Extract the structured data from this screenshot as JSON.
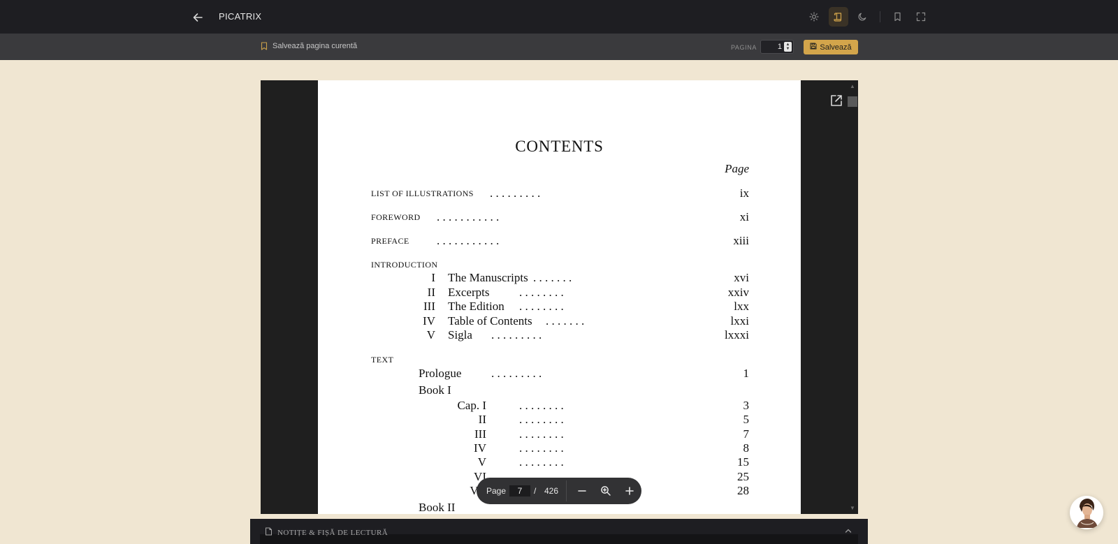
{
  "header": {
    "title": "PICATRIX"
  },
  "toolbar": {
    "save_current_label": "Salvează pagina curentă",
    "pagina_label": "PAGINA",
    "page_value": "1",
    "save_button_label": "Salvează"
  },
  "document": {
    "title": "CONTENTS",
    "page_header": "Page",
    "front_matter": [
      {
        "label": "LIST OF ILLUSTRATIONS",
        "dots": ". . . . . . . . .",
        "page": "ix"
      },
      {
        "label": "FOREWORD",
        "dots": ". . . . . . . . . . .",
        "page": "xi"
      },
      {
        "label": "PREFACE",
        "dots": ". . . . . . . . . . .",
        "page": "xiii"
      }
    ],
    "introduction_heading": "INTRODUCTION",
    "introduction": [
      {
        "num": "I",
        "label": "The Manuscripts",
        "dots": ". . . . . . .",
        "page": "xvi"
      },
      {
        "num": "II",
        "label": "Excerpts",
        "dots": ". . . . . . . .",
        "page": "xxiv"
      },
      {
        "num": "III",
        "label": "The Edition",
        "dots": ". . . . . . . .",
        "page": "lxx"
      },
      {
        "num": "IV",
        "label": "Table of Contents",
        "dots": ". . . . . . .",
        "page": "lxxi"
      },
      {
        "num": "V",
        "label": "Sigla",
        "dots": ". . . . . . . . .",
        "page": "lxxxi"
      }
    ],
    "text_heading": "TEXT",
    "prologue": {
      "label": "Prologue",
      "dots": ". . . . . . . . .",
      "page": "1"
    },
    "book1_heading": "Book I",
    "book1_chapters": [
      {
        "label": "Cap. I",
        "dots": ". . . . . . . .",
        "page": "3"
      },
      {
        "label": "II",
        "dots": ". . . . . . . .",
        "page": "5"
      },
      {
        "label": "III",
        "dots": ". . . . . . . .",
        "page": "7"
      },
      {
        "label": "IV",
        "dots": ". . . . . . . .",
        "page": "8"
      },
      {
        "label": "V",
        "dots": ". . . . . . . .",
        "page": "15"
      },
      {
        "label": "VI",
        "dots": ". . . . . . . .",
        "page": "25"
      },
      {
        "label": "VII",
        "dots": ". . . . . . . .",
        "page": "28"
      }
    ],
    "book2_heading": "Book II"
  },
  "pdf_toolbar": {
    "page_label": "Page",
    "current_page": "7",
    "separator": "/",
    "total_pages": "426"
  },
  "notes": {
    "title": "NOTIȚE & FIȘĂ DE LECTURĂ"
  },
  "colors": {
    "accent": "#d3a54b",
    "background": "#f0e6d2",
    "header": "#1e1e22"
  }
}
